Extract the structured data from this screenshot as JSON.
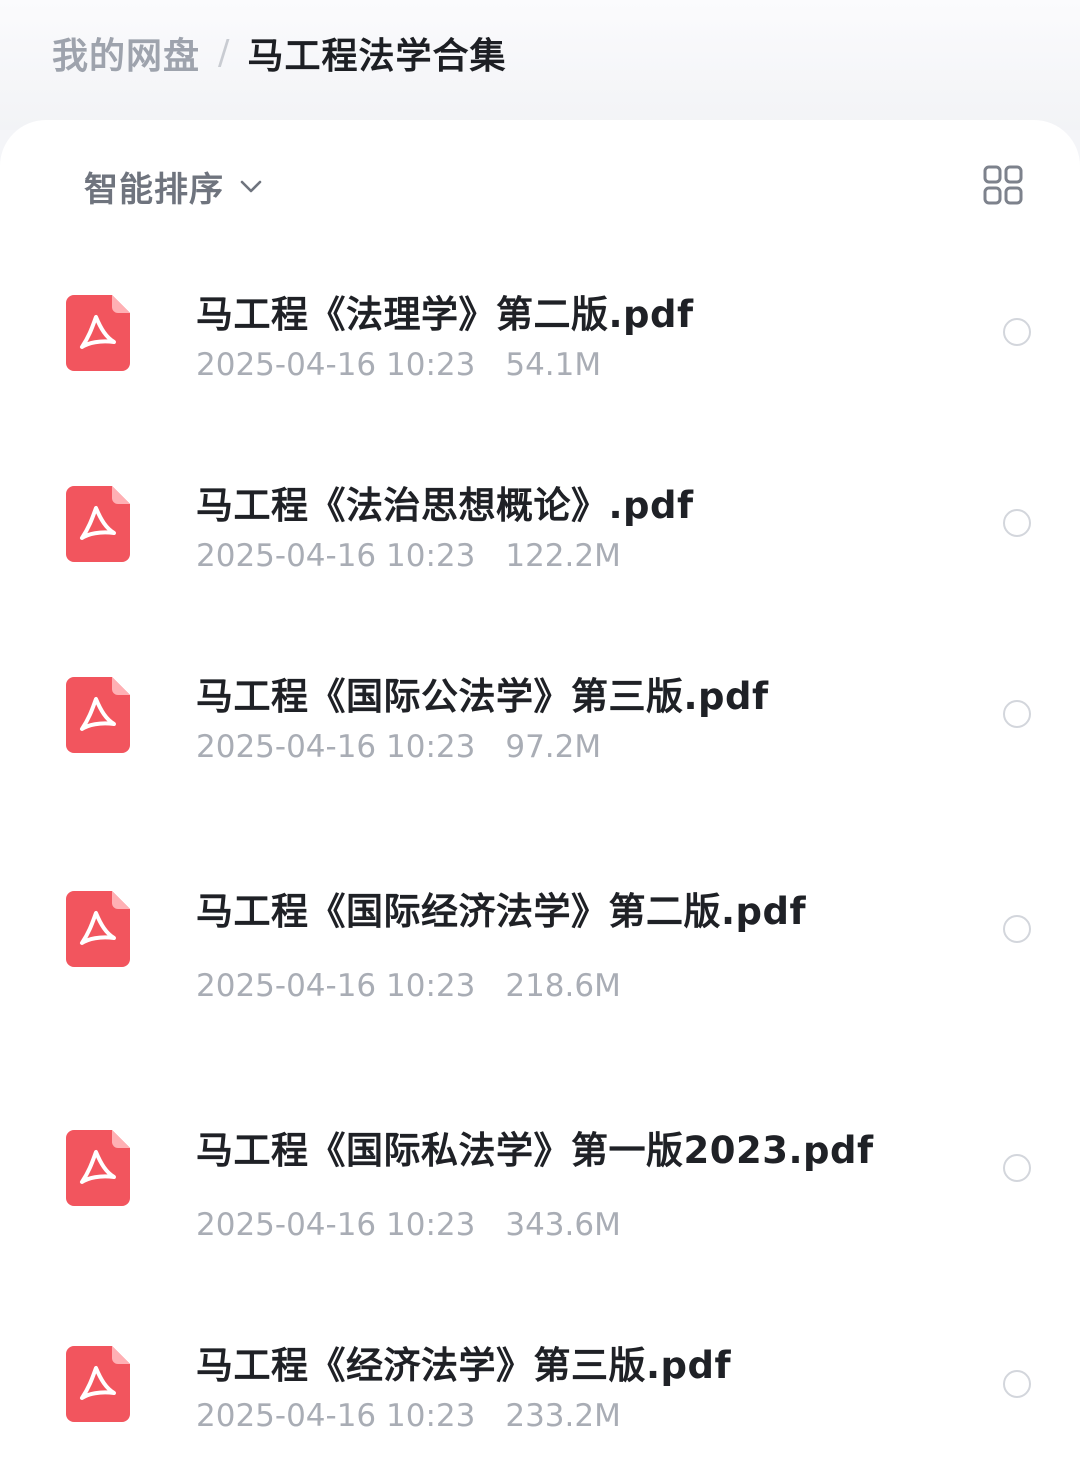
{
  "breadcrumb": {
    "root": "我的网盘",
    "separator": "/",
    "current": "马工程法学合集"
  },
  "toolbar": {
    "sort_label": "智能排序",
    "sort_icon": "chevron-down-icon",
    "view_icon": "grid-view-icon"
  },
  "colors": {
    "pdf_icon": "#f2555e",
    "title_text": "#1f2126",
    "meta_text": "#a9adb5"
  },
  "files": [
    {
      "name": "马工程《法理学》第二版.pdf",
      "date": "2025-04-16 10:23",
      "size": "54.1M",
      "icon": "pdf-file-icon"
    },
    {
      "name": "马工程《法治思想概论》.pdf",
      "date": "2025-04-16 10:23",
      "size": "122.2M",
      "icon": "pdf-file-icon"
    },
    {
      "name": "马工程《国际公法学》第三版.pdf",
      "date": "2025-04-16 10:23",
      "size": "97.2M",
      "icon": "pdf-file-icon"
    },
    {
      "name": "马工程《国际经济法学》第二版.pdf",
      "date": "2025-04-16 10:23",
      "size": "218.6M",
      "icon": "pdf-file-icon"
    },
    {
      "name": "马工程《国际私法学》第一版2023.pdf",
      "date": "2025-04-16 10:23",
      "size": "343.6M",
      "icon": "pdf-file-icon"
    },
    {
      "name": "马工程《经济法学》第三版.pdf",
      "date": "2025-04-16 10:23",
      "size": "233.2M",
      "icon": "pdf-file-icon"
    }
  ]
}
